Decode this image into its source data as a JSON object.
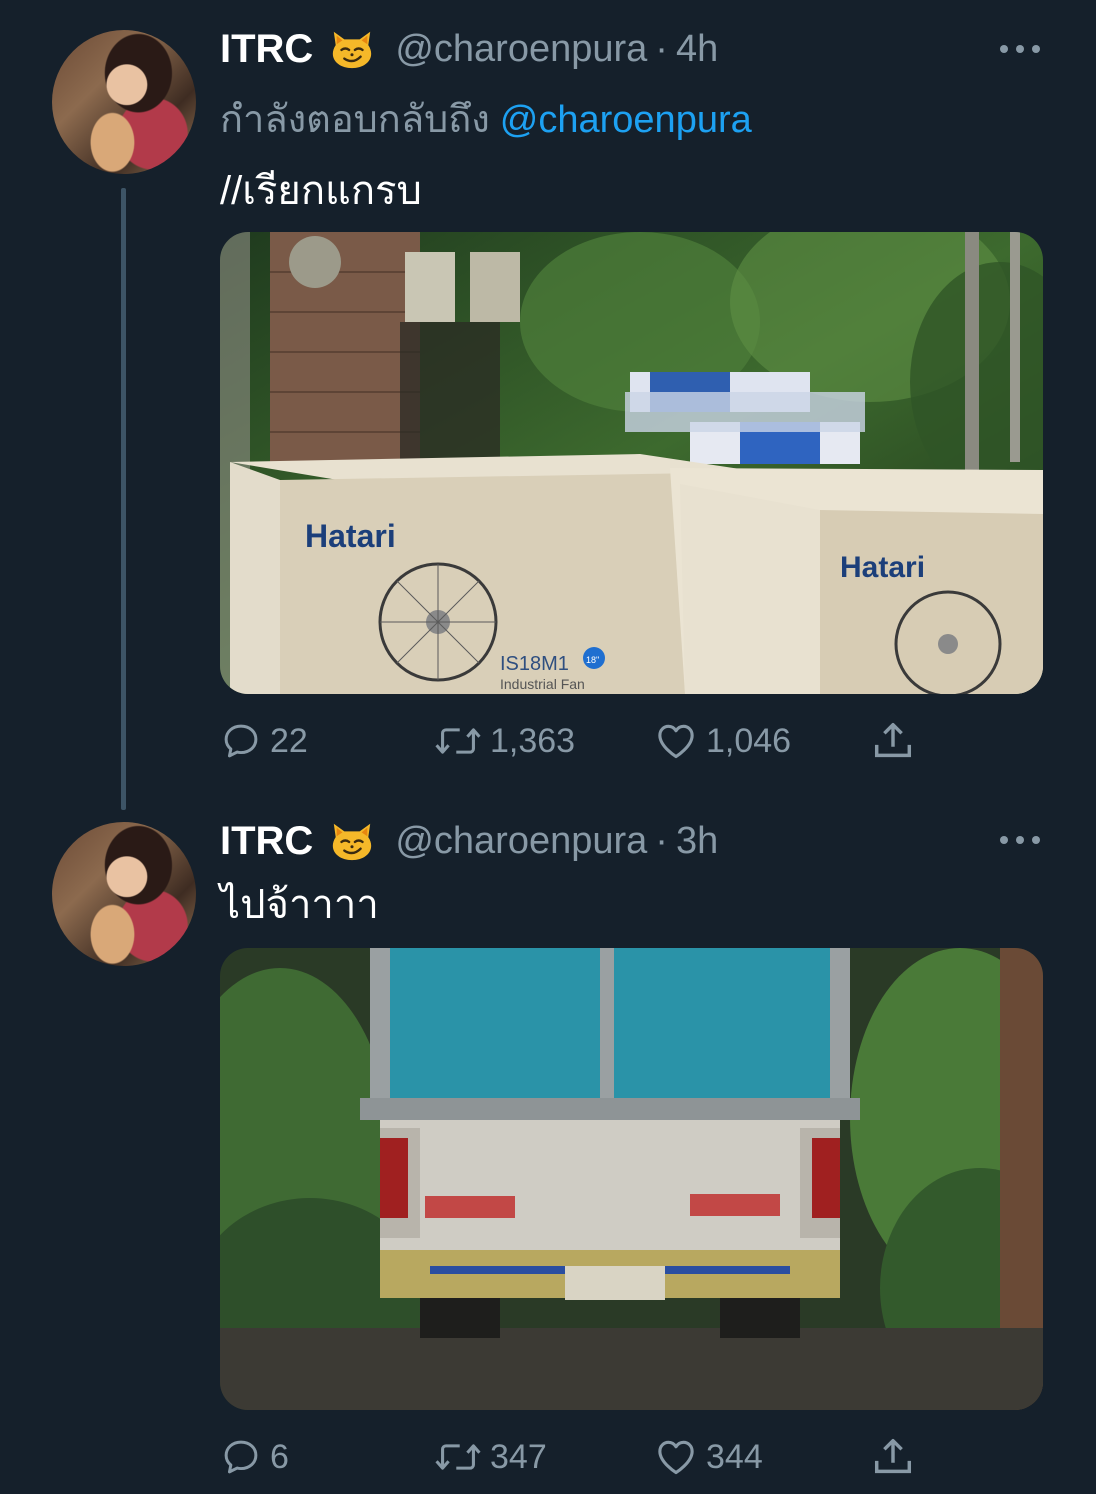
{
  "tweets": [
    {
      "display_name": "ITRC",
      "emoji": "smirking-cat-emoji",
      "handle": "@charoenpura",
      "separator": "·",
      "time": "4h",
      "reply_prefix": "กำลังตอบกลับถึง",
      "reply_mention": "@charoenpura",
      "text": "//เรียกแกรบ",
      "media": {
        "box_left_brand": "Hatari",
        "box_left_model": "IS18M1",
        "box_left_size": "18\"",
        "box_left_caption": "Industrial Fan",
        "box_right_brand": "Hatari"
      },
      "counts": {
        "replies": "22",
        "retweets": "1,363",
        "likes": "1,046"
      }
    },
    {
      "display_name": "ITRC",
      "emoji": "smirking-cat-emoji",
      "handle": "@charoenpura",
      "separator": "·",
      "time": "3h",
      "text": "ไปจ้าาาา",
      "counts": {
        "replies": "6",
        "retweets": "347",
        "likes": "344"
      }
    }
  ],
  "icons": [
    "more-icon",
    "reply-icon",
    "retweet-icon",
    "like-icon",
    "share-icon"
  ],
  "colors": {
    "background": "#15202b",
    "secondary_text": "#8899a6",
    "link": "#1da1f2",
    "thread_line": "#3d5466"
  }
}
